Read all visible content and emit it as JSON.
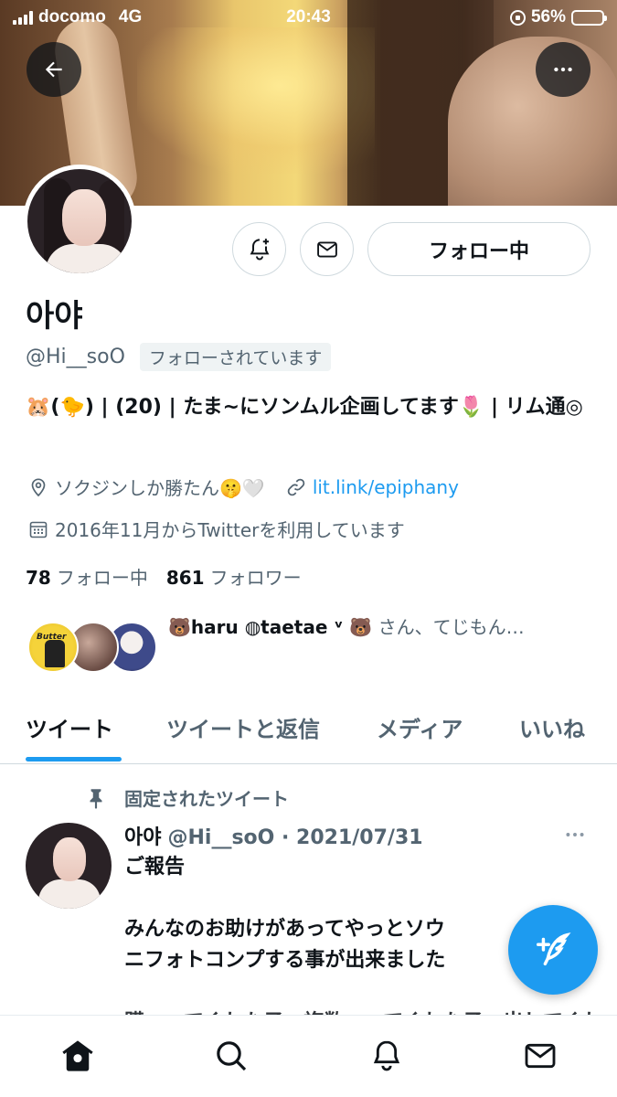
{
  "status_bar": {
    "carrier": "docomo",
    "network": "4G",
    "time": "20:43",
    "battery": "56%",
    "battery_level": 0.56
  },
  "profile": {
    "display_name": "아야",
    "handle": "@Hi__soO",
    "follows_you": "フォローされています",
    "follow_button": "フォロー中",
    "bio": "🐹(🐤) | (20) | たま~にソンムル企画してます🌷 | リム通◎",
    "location": "ソクジンしか勝たん🤫🤍",
    "link": "lit.link/epiphany",
    "joined": "2016年11月からTwitterを利用しています",
    "following_count": "78",
    "following_label": "フォロー中",
    "followers_count": "861",
    "followers_label": "フォロワー",
    "known_followers_names": "🐻haru ◍taetae ᵛ 🐻",
    "known_followers_suffix": "さん、てじもん…",
    "known_avatar_text": "Butter"
  },
  "tabs": [
    "ツイート",
    "ツイートと返信",
    "メディア",
    "いいね"
  ],
  "pinned_tweet": {
    "pinned_label": "固定されたツイート",
    "name": "아야",
    "handle_date": "@Hi__soO · 2021/07/31",
    "lines": [
      "ご報告",
      "",
      "みんなのお助けがあってやっとソウ",
      "ニフォトコンプする事が出来ました",
      "",
      "購　ってくれた子　複数　ってくれた子　出してくれた"
    ]
  },
  "colors": {
    "accent": "#1d9bf0",
    "text": "#0f1419",
    "secondary": "#536471",
    "border": "#cfd9de"
  },
  "icons": {
    "back": "arrow-left-icon",
    "more": "more-horizontal-icon",
    "bell": "bell-plus-icon",
    "dm": "envelope-icon",
    "location": "location-pin-icon",
    "link": "link-icon",
    "calendar": "calendar-icon",
    "pin": "pin-icon",
    "compose": "compose-feather-icon",
    "nav": [
      "home-icon",
      "search-icon",
      "bell-icon",
      "envelope-icon"
    ]
  }
}
